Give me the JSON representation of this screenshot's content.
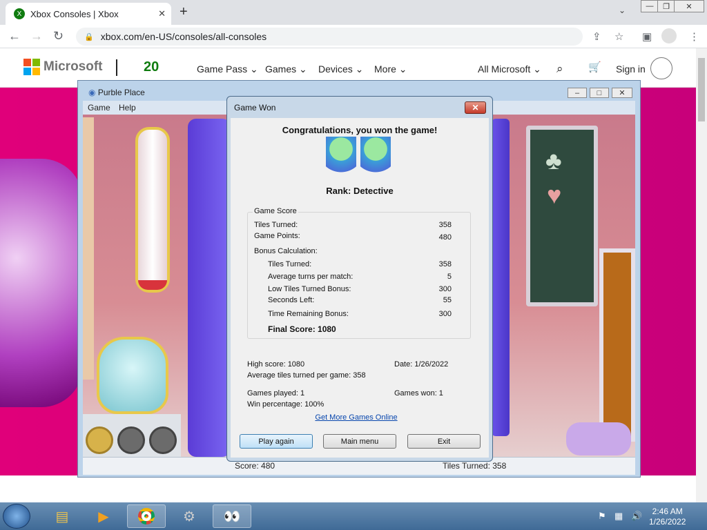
{
  "browser": {
    "tab_title": "Xbox Consoles | Xbox",
    "tab_close": "✕",
    "new_tab": "+",
    "url": "xbox.com/en-US/consoles/all-consoles",
    "window_controls": [
      "—",
      "❐",
      "✕"
    ]
  },
  "xbox_header": {
    "brand": "Microsoft",
    "logo20": "20",
    "nav": [
      "Game Pass",
      "Games",
      "Devices",
      "More"
    ],
    "all_microsoft": "All Microsoft",
    "sign_in": "Sign in"
  },
  "purble": {
    "window_title": "Purble Place",
    "menu": [
      "Game",
      "Help"
    ],
    "status_score": "Score: 480",
    "status_tiles": "Tiles Turned: 358"
  },
  "dialog": {
    "title": "Game Won",
    "congrats": "Congratulations, you won the game!",
    "rank": "Rank: Detective",
    "game_score_label": "Game Score",
    "rows": [
      {
        "label": "Tiles Turned:",
        "value": "358"
      },
      {
        "label": "Game Points:",
        "value": "480"
      }
    ],
    "bonus_label": "Bonus Calculation:",
    "bonus_rows": [
      {
        "label": "Tiles Turned:",
        "value": "358"
      },
      {
        "label": "Average turns per match:",
        "value": "5"
      },
      {
        "label": "Low Tiles Turned Bonus:",
        "value": "300"
      },
      {
        "label": "Seconds Left:",
        "value": "55"
      },
      {
        "label": "Time Remaining Bonus:",
        "value": "300"
      }
    ],
    "final_score": "Final Score: 1080",
    "high_score": "High score: 1080",
    "date": "Date: 1/26/2022",
    "avg_tiles": "Average tiles turned per game: 358",
    "games_played": "Games played: 1",
    "games_won": "Games won: 1",
    "win_pct": "Win percentage: 100%",
    "link": "Get More Games Online",
    "buttons": [
      "Play again",
      "Main menu",
      "Exit"
    ]
  },
  "taskbar": {
    "time": "2:46 AM",
    "date": "1/26/2022"
  },
  "colors": {
    "page_pink": "#d10077",
    "xbox_green": "#107c10",
    "link_blue": "#0645ad"
  }
}
